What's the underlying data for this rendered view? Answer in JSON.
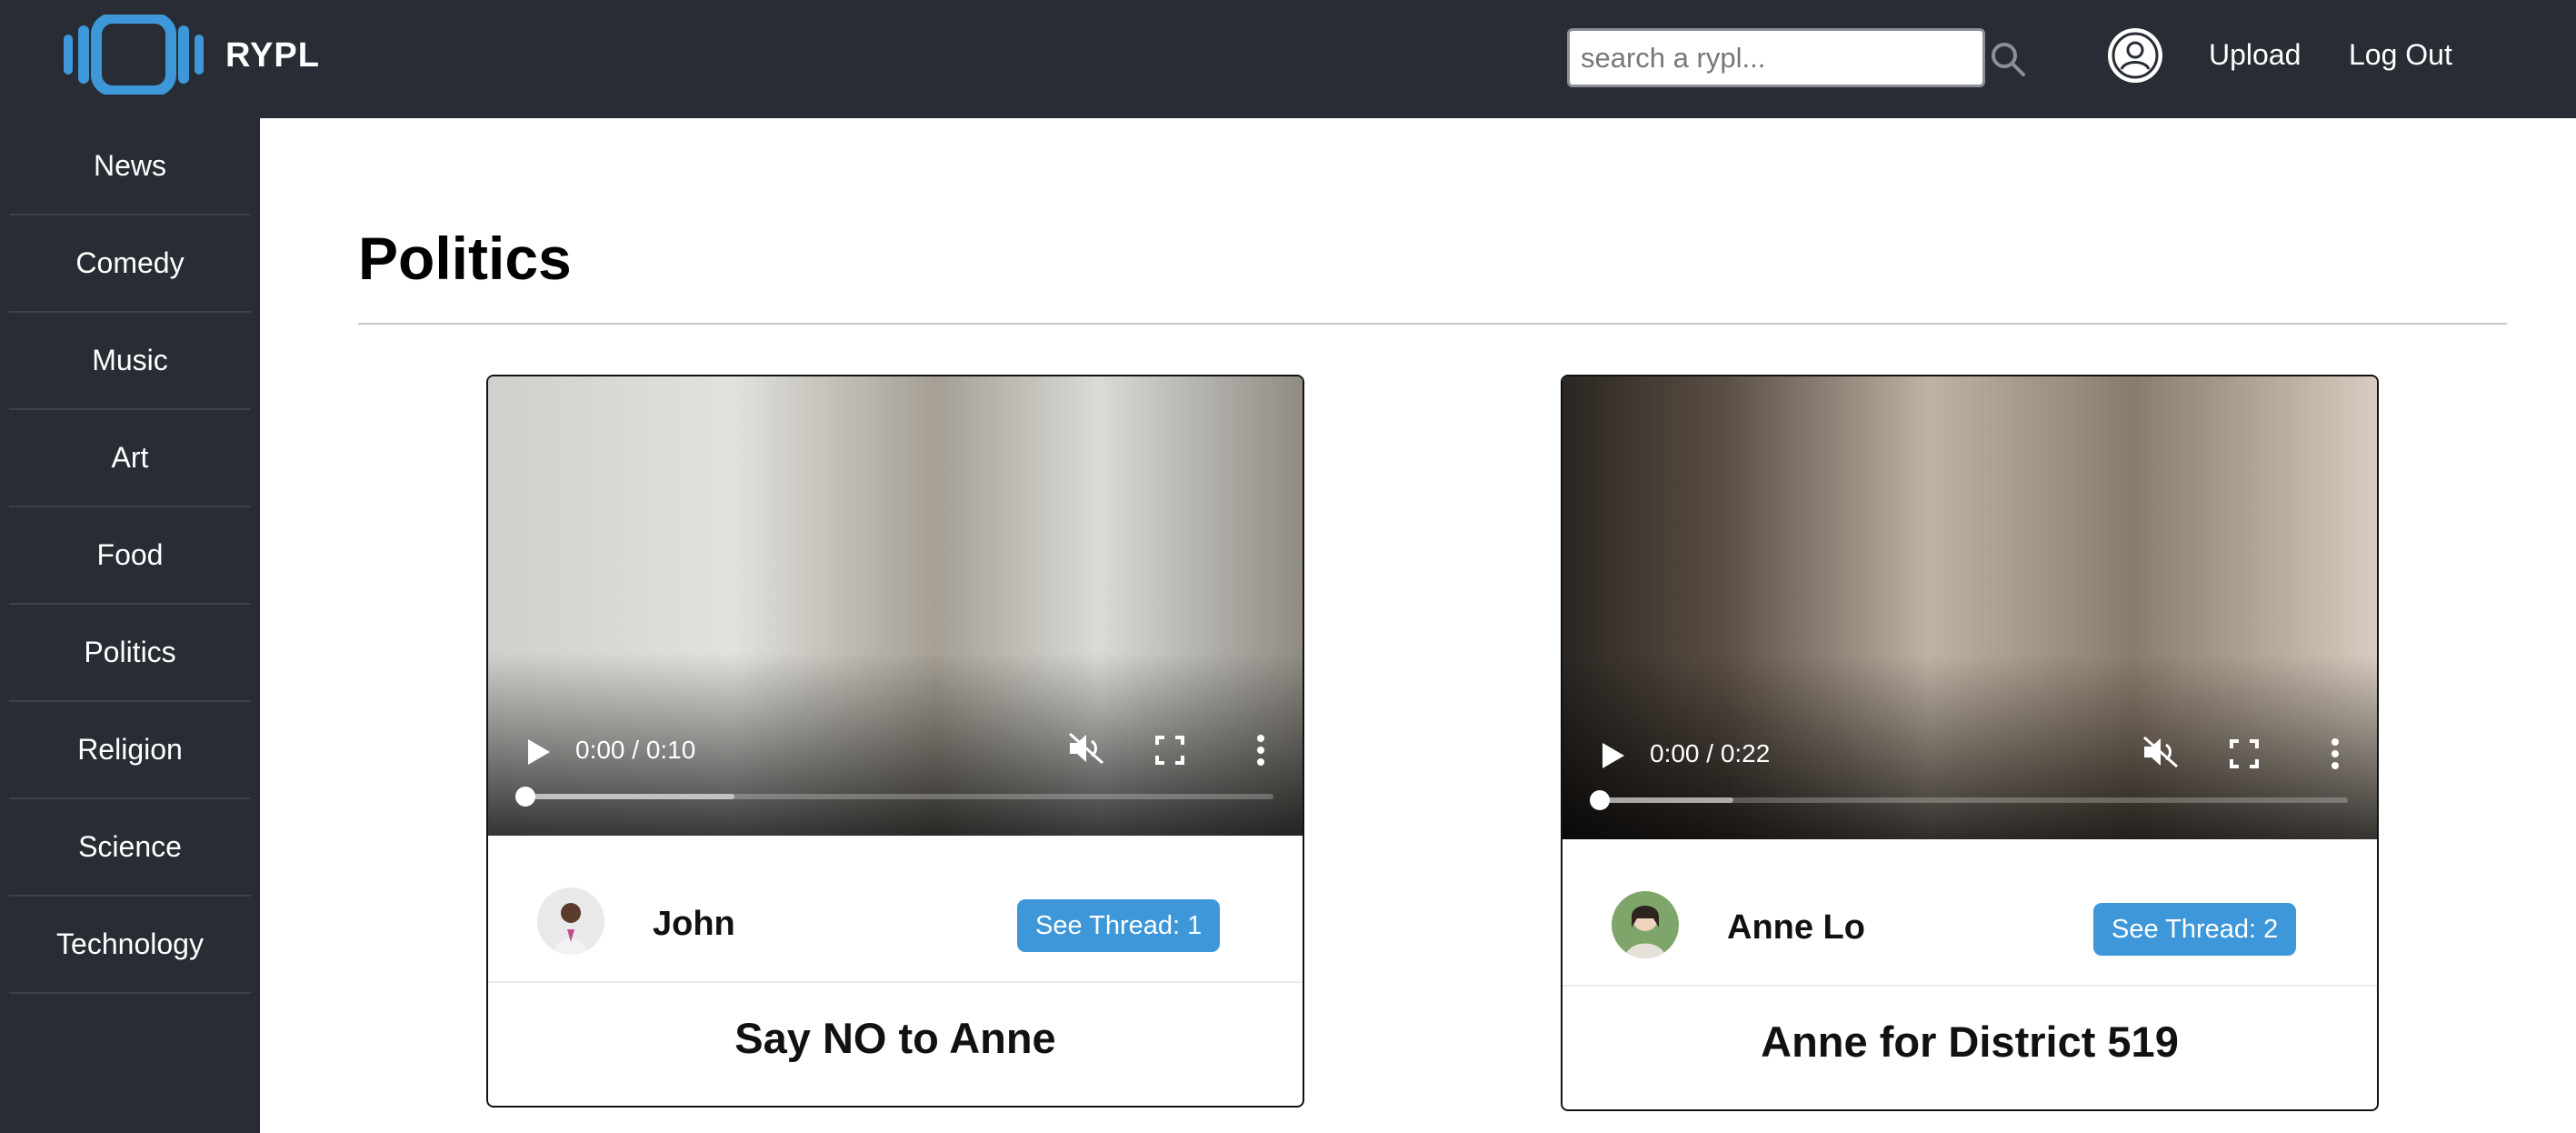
{
  "header": {
    "brand": "RYPL",
    "search_placeholder": "search a rypl...",
    "upload_label": "Upload",
    "logout_label": "Log Out",
    "background_color": "#282c34",
    "accent_color": "#3d97d9"
  },
  "sidebar": {
    "items": [
      {
        "label": "News"
      },
      {
        "label": "Comedy"
      },
      {
        "label": "Music"
      },
      {
        "label": "Art"
      },
      {
        "label": "Food"
      },
      {
        "label": "Politics"
      },
      {
        "label": "Religion"
      },
      {
        "label": "Science"
      },
      {
        "label": "Technology"
      }
    ]
  },
  "main": {
    "title": "Politics",
    "cards": [
      {
        "video_time": "0:00 / 0:10",
        "author": "John",
        "thread_label": "See Thread: 1",
        "title": "Say NO to Anne"
      },
      {
        "video_time": "0:00 / 0:22",
        "author": "Anne Lo",
        "thread_label": "See Thread: 2",
        "title": "Anne for District 519"
      }
    ]
  }
}
